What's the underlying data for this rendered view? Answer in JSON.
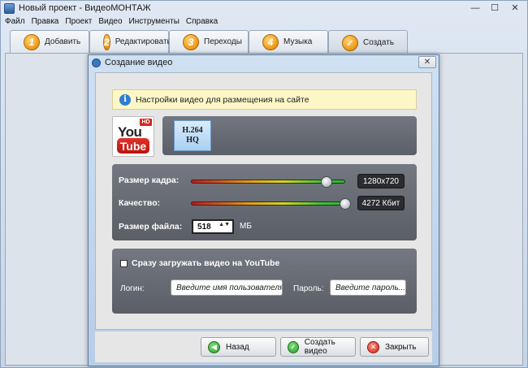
{
  "window": {
    "title": "Новый проект - ВидеоМОНТАЖ",
    "min_glyph": "—",
    "max_glyph": "☐",
    "close_glyph": "✕"
  },
  "menu": [
    "Файл",
    "Правка",
    "Проект",
    "Видео",
    "Инструменты",
    "Справка"
  ],
  "tabs": [
    {
      "num": "1",
      "label": "Добавить"
    },
    {
      "num": "2",
      "label": "Редактировать"
    },
    {
      "num": "3",
      "label": "Переходы"
    },
    {
      "num": "4",
      "label": "Музыка"
    },
    {
      "num": "✓",
      "label": "Создать",
      "active": true
    }
  ],
  "dialog": {
    "title": "Создание видео",
    "close_glyph": "✕",
    "info_icon": "i",
    "info_text": "Настройки видео для размещения на сайте",
    "logo": {
      "you": "You",
      "tube": "Tube",
      "hd": "HD"
    },
    "format": {
      "line1": "H.264",
      "line2": "HQ"
    },
    "settings": {
      "frame_label": "Размер кадра:",
      "frame_value": "1280x720",
      "frame_level": 0.88,
      "quality_label": "Качество:",
      "quality_value": "4272 Кбит",
      "quality_level": 1.0,
      "size_label": "Размер файла:",
      "size_value": "518",
      "size_arrows": "▲▼",
      "size_unit": "МБ"
    },
    "upload": {
      "checkbox_label": "Сразу загружать видео на YouTube",
      "checked": false,
      "login_label": "Логин:",
      "login_placeholder": "Введите имя пользователя...",
      "password_label": "Пароль:",
      "password_placeholder": "Введите пароль..."
    },
    "buttons": {
      "back": "Назад",
      "create": "Создать видео",
      "close": "Закрыть",
      "back_icon": "◀",
      "create_icon": "✓",
      "close_icon": "✕"
    }
  },
  "colors": {
    "accent_orange": "#f0a020",
    "panel_gray": "#62666e",
    "info_bg": "#fdf7c8"
  }
}
